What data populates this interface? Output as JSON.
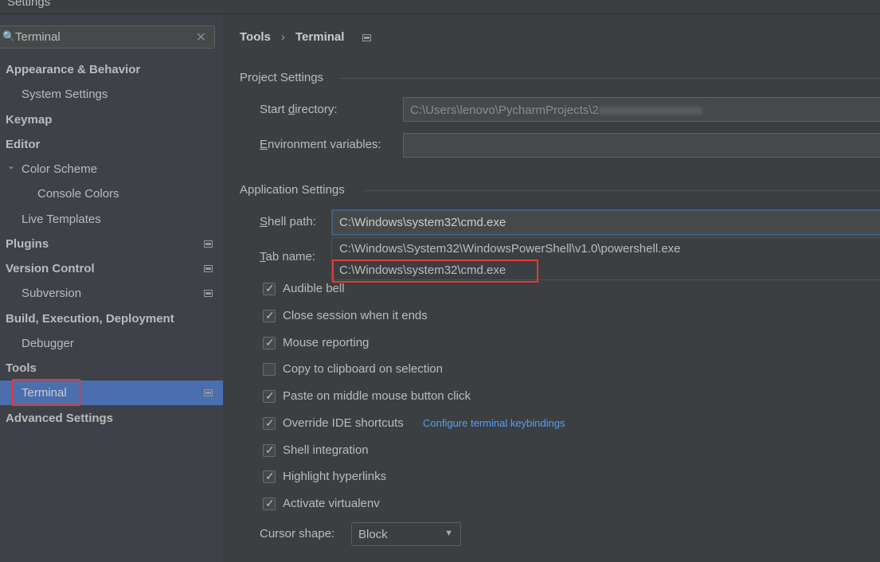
{
  "window": {
    "title": "Settings"
  },
  "search": {
    "value": "Terminal",
    "icon": "search-icon",
    "clear_icon": "close-icon"
  },
  "sidebar": {
    "items": [
      {
        "label": "Appearance & Behavior",
        "level": 0
      },
      {
        "label": "System Settings",
        "level": 1
      },
      {
        "label": "Keymap",
        "level": 0
      },
      {
        "label": "Editor",
        "level": 0
      },
      {
        "label": "Color Scheme",
        "level": 1,
        "expanded": true
      },
      {
        "label": "Console Colors",
        "level": 2
      },
      {
        "label": "Live Templates",
        "level": 1
      },
      {
        "label": "Plugins",
        "level": 0,
        "pinned": true
      },
      {
        "label": "Version Control",
        "level": 0,
        "pinned": true
      },
      {
        "label": "Subversion",
        "level": 1,
        "pinned": true
      },
      {
        "label": "Build, Execution, Deployment",
        "level": 0
      },
      {
        "label": "Debugger",
        "level": 1
      },
      {
        "label": "Tools",
        "level": 0
      },
      {
        "label": "Terminal",
        "level": 1,
        "selected": true,
        "pinned": true
      },
      {
        "label": "Advanced Settings",
        "level": 0
      }
    ]
  },
  "breadcrumb": {
    "parent": "Tools",
    "separator": "›",
    "current": "Terminal"
  },
  "project": {
    "title": "Project Settings",
    "start_dir_label_pre": "Start ",
    "start_dir_label_u": "d",
    "start_dir_label_post": "irectory:",
    "start_dir_value": "C:\\Users\\lenovo\\PycharmProjects\\2",
    "env_label_u": "E",
    "env_label_post": "nvironment variables:",
    "env_value": ""
  },
  "app": {
    "title": "Application Settings",
    "shell_label_u": "S",
    "shell_label_post": "hell path:",
    "shell_value": "C:\\Windows\\system32\\cmd.exe",
    "shell_options": [
      "C:\\Windows\\System32\\WindowsPowerShell\\v1.0\\powershell.exe",
      "C:\\Windows\\system32\\cmd.exe"
    ],
    "tab_label_u": "T",
    "tab_label_post": "ab name:",
    "checkboxes": [
      {
        "label": "Audible bell",
        "checked": true
      },
      {
        "label": "Close session when it ends",
        "checked": true
      },
      {
        "label": "Mouse reporting",
        "checked": true
      },
      {
        "label": "Copy to clipboard on selection",
        "checked": false
      },
      {
        "label": "Paste on middle mouse button click",
        "checked": true
      },
      {
        "label": "Override IDE shortcuts",
        "checked": true
      },
      {
        "label": "Shell integration",
        "checked": true
      },
      {
        "label": "Highlight hyperlinks",
        "checked": true
      },
      {
        "label": "Activate virtualenv",
        "checked": true
      }
    ],
    "keybindings_link": "Configure terminal keybindings",
    "cursor_label": "Cursor shape:",
    "cursor_value": "Block"
  },
  "colors": {
    "selection": "#4b6eaf",
    "link": "#589df6",
    "highlight": "#e53935",
    "focus": "#3d6185"
  }
}
